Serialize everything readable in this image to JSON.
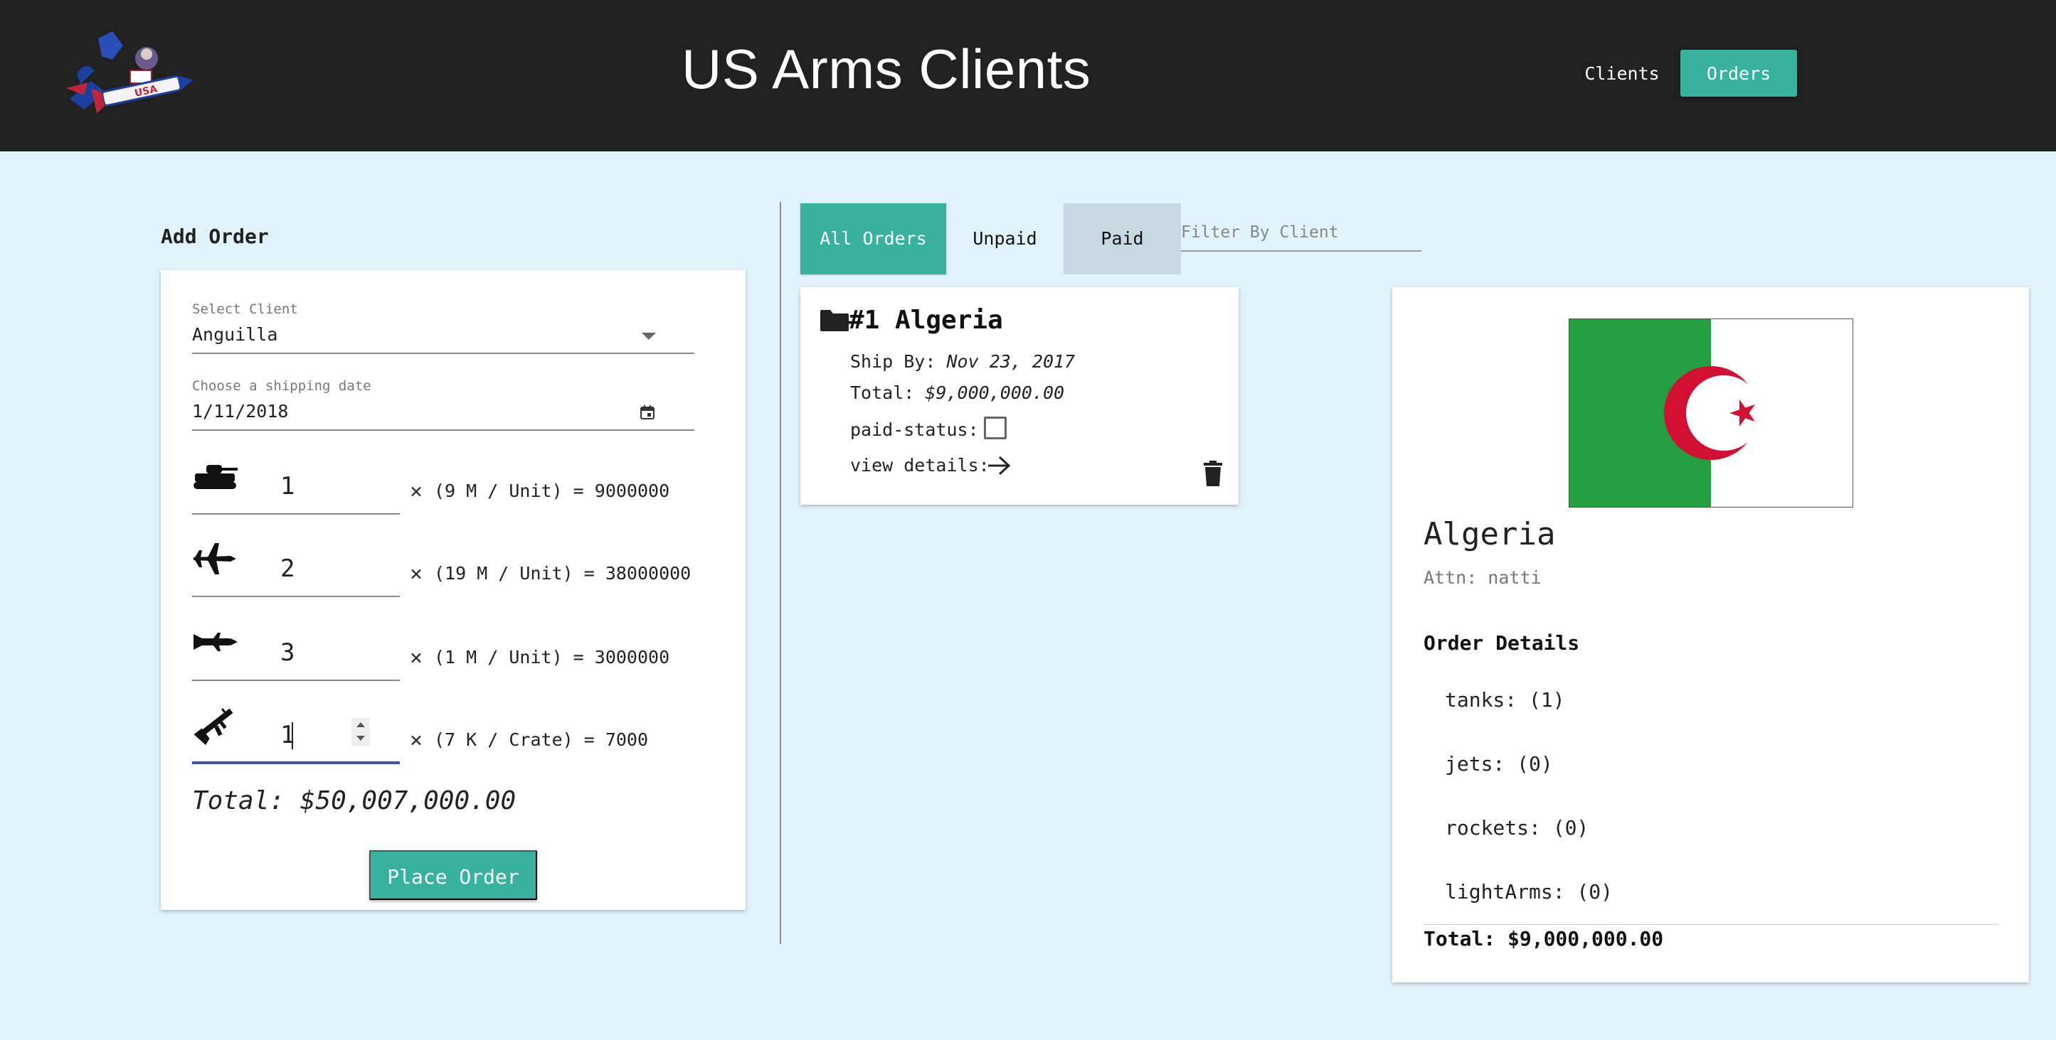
{
  "header": {
    "title": "US Arms Clients",
    "logo_label": "USA",
    "nav": {
      "clients": "Clients",
      "orders": "Orders"
    }
  },
  "add_order": {
    "heading": "Add Order",
    "client_label": "Select Client",
    "client_value": "Anguilla",
    "date_label": "Choose a shipping date",
    "date_value": "1/11/2018",
    "rows": [
      {
        "icon": "tank-icon",
        "qty": "1",
        "formula": "(9 M / Unit) = 9000000"
      },
      {
        "icon": "jet-icon",
        "qty": "2",
        "formula": "(19 M / Unit) = 38000000"
      },
      {
        "icon": "rocket-icon",
        "qty": "3",
        "formula": "(1 M / Unit) = 3000000"
      },
      {
        "icon": "rifle-icon",
        "qty": "1",
        "formula": "(7 K / Crate) = 7000"
      }
    ],
    "times_symbol": "×",
    "total": "Total: $50,007,000.00",
    "place_order": "Place Order"
  },
  "orders": {
    "tabs": {
      "all": "All Orders",
      "unpaid": "Unpaid",
      "paid": "Paid"
    },
    "filter_placeholder": "Filter By Client",
    "cards": [
      {
        "title": "#1 Algeria",
        "ship_by_label": "Ship By:",
        "ship_by_value": "Nov 23, 2017",
        "total_label": "Total:",
        "total_value": "$9,000,000.00",
        "paid_status_label": "paid-status:",
        "paid": false,
        "view_details_label": "view details:"
      }
    ]
  },
  "detail": {
    "country": "Algeria",
    "attn": "Attn: natti",
    "heading": "Order Details",
    "items": [
      "tanks: (1)",
      "jets: (0)",
      "rockets: (0)",
      "lightArms: (0)"
    ],
    "total": "Total: $9,000,000.00"
  },
  "colors": {
    "header_bg": "#212121",
    "accent": "#37b29e",
    "page_bg": "#e0f3fb",
    "paid_tab_bg": "#c7d8e0",
    "active_input": "#3f51b5",
    "flag_green": "#239f40",
    "flag_red": "#d21034"
  }
}
